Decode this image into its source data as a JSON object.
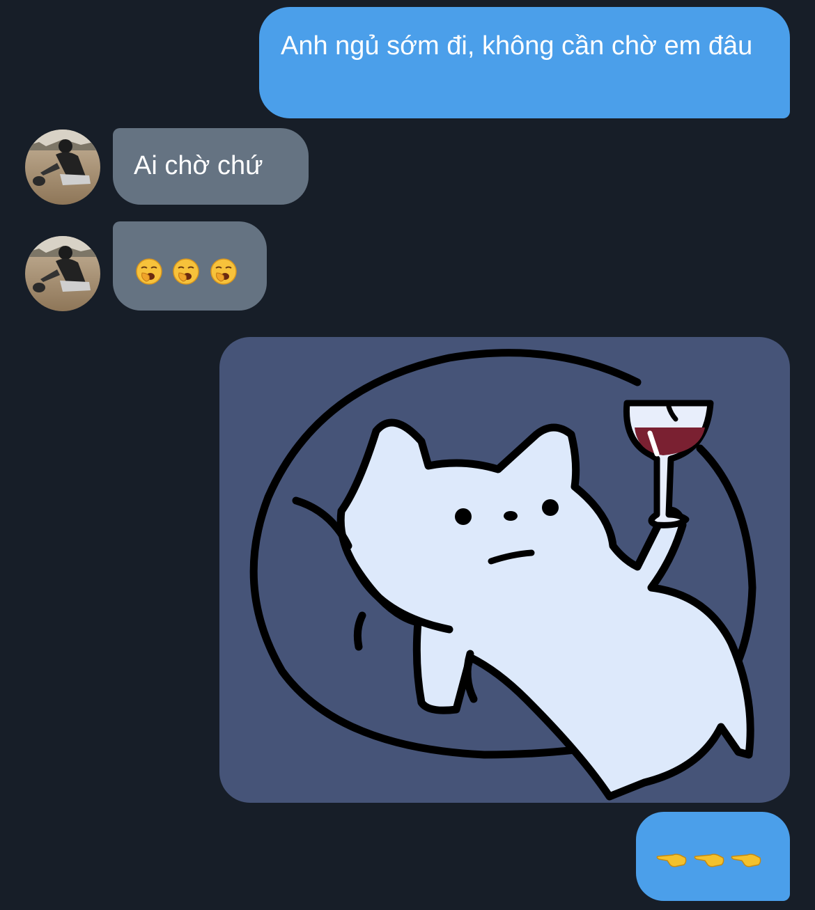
{
  "messages": [
    {
      "id": "m1",
      "direction": "outgoing",
      "type": "text",
      "text": "Anh ngủ sớm đi, không cần chờ em đâu"
    },
    {
      "id": "m2",
      "direction": "incoming",
      "type": "text",
      "text": "Ai chờ chứ"
    },
    {
      "id": "m3",
      "direction": "incoming",
      "type": "emoji",
      "emoji": [
        "yawning-face-icon",
        "yawning-face-icon",
        "yawning-face-icon"
      ]
    },
    {
      "id": "m4",
      "direction": "outgoing",
      "type": "sticker",
      "sticker": "cat-with-wine-sticker"
    },
    {
      "id": "m5",
      "direction": "outgoing",
      "type": "emoji",
      "emoji": [
        "backhand-index-pointing-left-icon",
        "backhand-index-pointing-left-icon",
        "backhand-index-pointing-left-icon"
      ]
    }
  ],
  "colors": {
    "background": "#171e28",
    "outgoing_bubble": "#4b9fea",
    "incoming_bubble": "#657382",
    "sticker_background": "#465478"
  }
}
